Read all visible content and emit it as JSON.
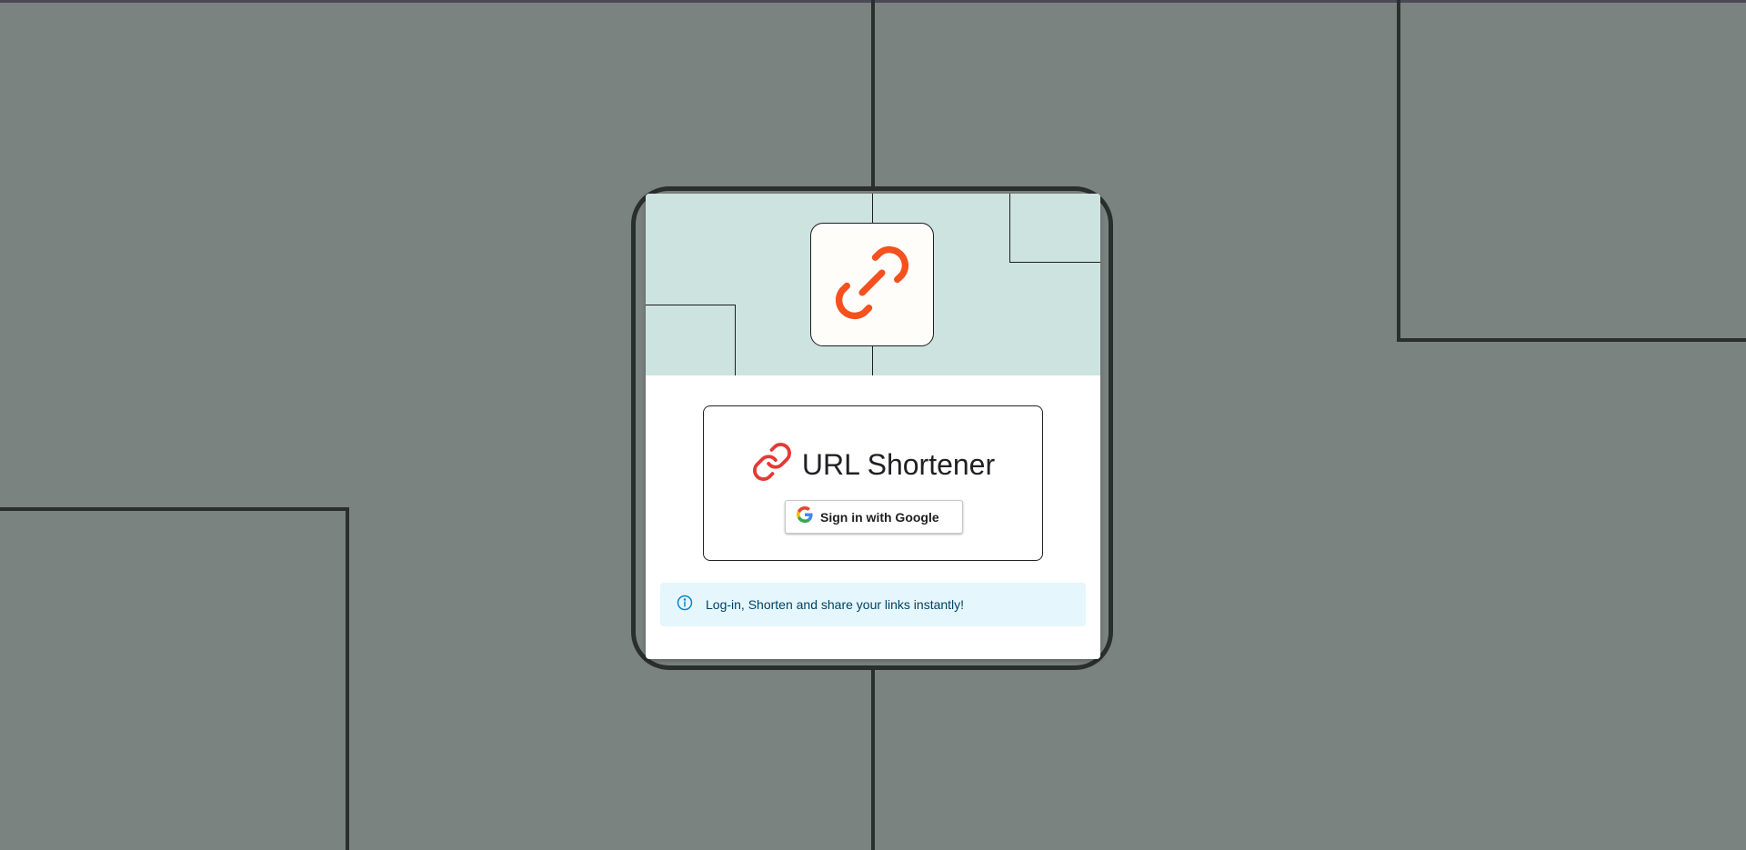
{
  "app": {
    "title": "URL Shortener"
  },
  "login_card": {
    "hero_icon": "link-icon",
    "title_icon": "link-icon",
    "title": "URL Shortener",
    "sign_in_button": {
      "icon": "google-g-icon",
      "label": "Sign in with Google"
    },
    "info": {
      "icon": "info-icon",
      "text": "Log-in, Shorten and share your links instantly!"
    }
  },
  "colors": {
    "background": "#7b8381",
    "hero_background": "#cde3e0",
    "hero_link": "#f4511e",
    "title_link": "#e53935",
    "info_background": "#e5f6fd",
    "info_accent": "#0288d1"
  }
}
